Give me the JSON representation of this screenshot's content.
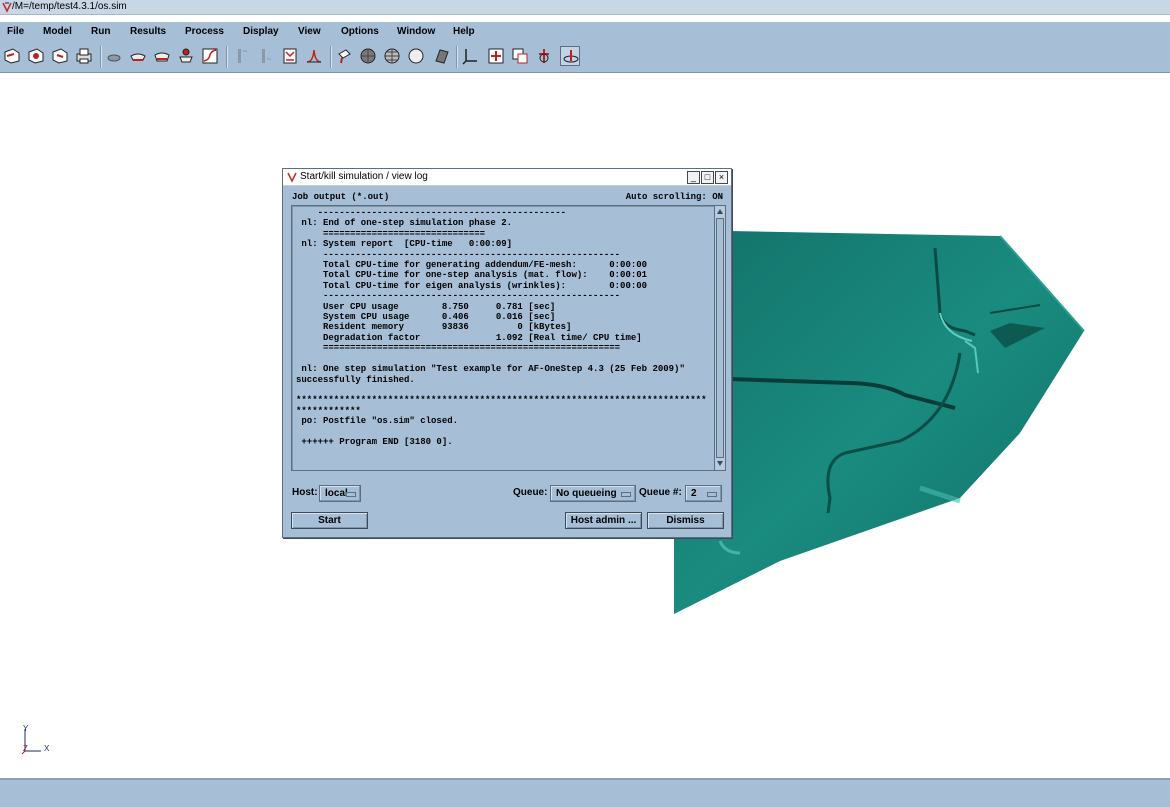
{
  "window": {
    "title": "/M=/temp/test4.3.1/os.sim"
  },
  "menu": [
    "File",
    "Model",
    "Run",
    "Results",
    "Process",
    "Display",
    "View",
    "Options",
    "Window",
    "Help"
  ],
  "toolbar": {
    "icons": [
      "open-file-icon",
      "save-file-icon",
      "import-file-icon",
      "print-icon",
      "cylinder-icon",
      "die-tool-icon",
      "blank-tool-icon",
      "multi-tool-icon",
      "curve-icon",
      "edge-filter-icon",
      "surface-filter-icon",
      "matrix-icon",
      "peak-curve-icon",
      "light-source-icon",
      "shade-sphere-icon",
      "mesh-sphere-icon",
      "white-sphere-icon",
      "flat-plane-icon",
      "axis-triad-icon",
      "fit-view-icon",
      "zoom-window-icon",
      "rotate-view-icon",
      "reset-view-icon"
    ]
  },
  "axis": {
    "y_label": "Y",
    "z_label": "Z",
    "x_label": "X"
  },
  "dialog": {
    "title": "Start/kill simulation / view log",
    "minimize": "_",
    "maximize": "□",
    "close": "×",
    "job_output_label": "Job output (*.out)",
    "auto_scroll_label": "Auto scrolling: ON",
    "log_lines": [
      "    ----------------------------------------------",
      " nl: End of one-step simulation phase 2.",
      "     ==============================",
      " nl: System report  [CPU-time   0:00:09]",
      "     -------------------------------------------------------",
      "     Total CPU-time for generating addendum/FE-mesh:      0:00:00",
      "     Total CPU-time for one-step analysis (mat. flow):    0:00:01",
      "     Total CPU-time for eigen analysis (wrinkles):        0:00:00",
      "     -------------------------------------------------------",
      "     User CPU usage        8.750     0.781 [sec]",
      "     System CPU usage      0.406     0.016 [sec]",
      "     Resident memory       93836         0 [kBytes]",
      "     Degradation factor              1.092 [Real time/ CPU time]",
      "     =======================================================",
      "",
      " nl: One step simulation \"Test example for AF-OneStep 4.3 (25 Feb 2009)\"",
      "successfully finished.",
      "",
      "****************************************************************************",
      "************",
      " po: Postfile \"os.sim\" closed.",
      "",
      " ++++++ Program END [3180 0]."
    ],
    "host_label": "Host:",
    "host_value": "local",
    "queue_label": "Queue:",
    "queue_value": "No queueing",
    "queue_num_label": "Queue #:",
    "queue_num_value": "2",
    "start_label": "Start",
    "host_admin_label": "Host admin ...",
    "dismiss_label": "Dismiss"
  },
  "colors": {
    "chrome": "#a6bed6",
    "part": "#1b8a7e",
    "titlebar": "#c8d6e6"
  }
}
